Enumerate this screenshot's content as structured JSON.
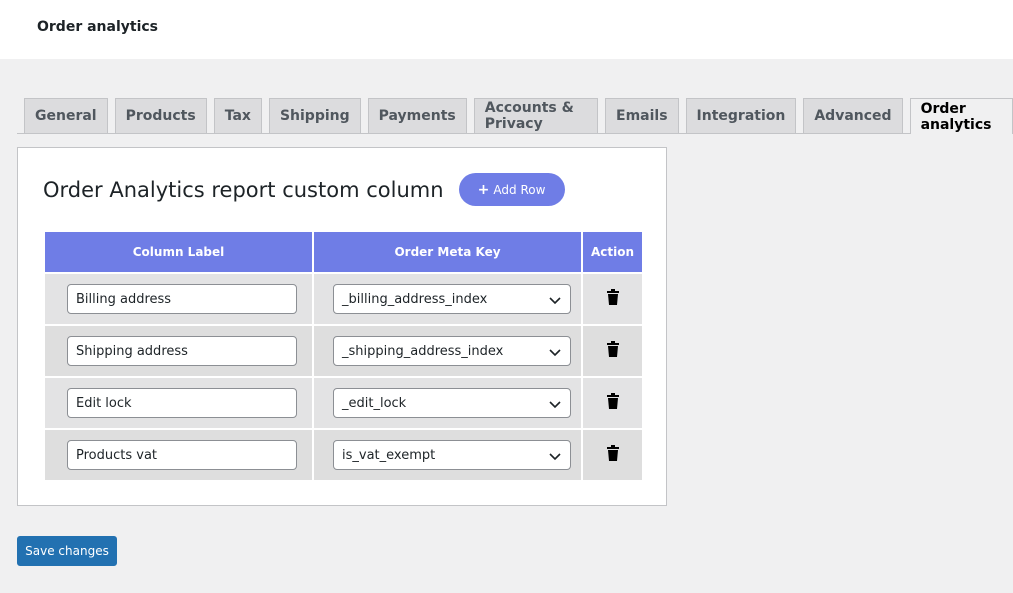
{
  "header": {
    "title": "Order analytics"
  },
  "tabs": [
    {
      "label": "General",
      "active": false
    },
    {
      "label": "Products",
      "active": false
    },
    {
      "label": "Tax",
      "active": false
    },
    {
      "label": "Shipping",
      "active": false
    },
    {
      "label": "Payments",
      "active": false
    },
    {
      "label": "Accounts & Privacy",
      "active": false
    },
    {
      "label": "Emails",
      "active": false
    },
    {
      "label": "Integration",
      "active": false
    },
    {
      "label": "Advanced",
      "active": false
    },
    {
      "label": "Order analytics",
      "active": true
    }
  ],
  "panel": {
    "title": "Order Analytics report custom column",
    "add_row_label": "Add Row",
    "add_row_icon": "+",
    "columns": {
      "label": "Column Label",
      "meta_key": "Order Meta Key",
      "action": "Action"
    },
    "rows": [
      {
        "label": "Billing address",
        "meta_key": "_billing_address_index",
        "action_icon": "trash-icon"
      },
      {
        "label": "Shipping address",
        "meta_key": "_shipping_address_index",
        "action_icon": "trash-icon"
      },
      {
        "label": "Edit lock",
        "meta_key": "_edit_lock",
        "action_icon": "trash-icon"
      },
      {
        "label": "Products vat",
        "meta_key": "is_vat_exempt",
        "action_icon": "trash-icon"
      }
    ]
  },
  "footer": {
    "save_label": "Save changes"
  },
  "colors": {
    "accent": "#6f7de6",
    "primary_button": "#2271b1",
    "background": "#f0f0f1"
  }
}
